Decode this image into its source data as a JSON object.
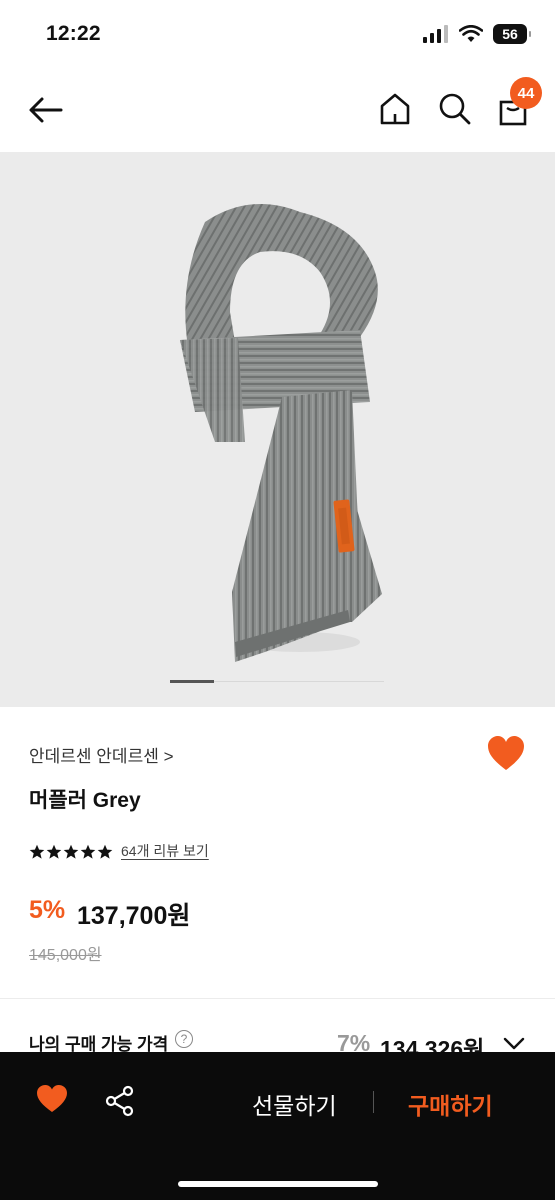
{
  "status_bar": {
    "time": "12:22",
    "battery": "56"
  },
  "nav": {
    "cart_count": "44"
  },
  "product": {
    "brand": "안데르센 안데르센 >",
    "title": "머플러 Grey",
    "rating_stars": 5,
    "review_link": "64개 리뷰 보기",
    "discount": "5%",
    "price": "137,700원",
    "original_price": "145,000원",
    "image_pages": 1
  },
  "member_price": {
    "label": "나의 구매 가능 가격",
    "help": "?",
    "rate": "7%",
    "price": "134,326원"
  },
  "bottom_bar": {
    "gift_label": "선물하기",
    "buy_label": "구매하기"
  },
  "colors": {
    "accent": "#f25c1f",
    "bottom_bar": "#0b0b0b",
    "image_bg": "#ebebeb"
  }
}
